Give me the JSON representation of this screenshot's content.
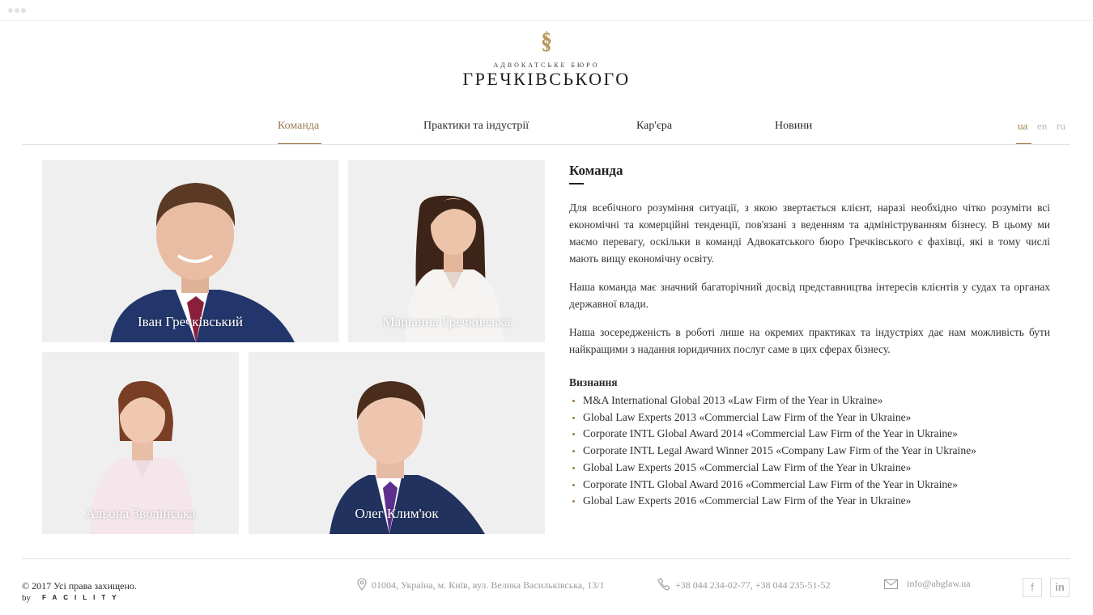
{
  "logo": {
    "subtitle": "Адвокатське бюро",
    "name": "ГРЕЧКІВСЬКОГО"
  },
  "nav": {
    "items": [
      {
        "label": "Команда",
        "active": true
      },
      {
        "label": "Практики та індустрії",
        "active": false
      },
      {
        "label": "Кар'єра",
        "active": false
      },
      {
        "label": "Новини",
        "active": false
      }
    ],
    "languages": [
      {
        "label": "ua",
        "active": true
      },
      {
        "label": "en",
        "active": false
      },
      {
        "label": "ru",
        "active": false
      }
    ]
  },
  "team": [
    {
      "name": "Іван Гречківський"
    },
    {
      "name": "Маріанна Гречківська"
    },
    {
      "name": "Альона Зволінська"
    },
    {
      "name": "Олег Клим'юк"
    }
  ],
  "content": {
    "title": "Команда",
    "paragraphs": [
      "Для всебічного розуміння ситуації, з якою звертається клієнт, наразі необхідно чітко розуміти всі економічні та комерційні тенденції, пов'язані з веденням та адмініструванням бізнесу. В цьому ми маємо перевагу, оскільки в команді Адвокатського бюро Гречківського є фахівці, які в тому числі мають вищу економічну освіту.",
      "Наша команда має значний багаторічний досвід представництва інтересів клієнтів у судах та органах державної влади.",
      "Наша зосередженість в роботі лише на окремих практиках та індустріях дає нам можливість бути найкращими з надання юридичних послуг саме в цих сферах бізнесу."
    ],
    "recognition_title": "Визнання",
    "recognitions": [
      "M&A International Global 2013 «Law Firm of the Year in Ukraine»",
      "Global Law Experts 2013 «Commercial Law Firm of the Year in Ukraine»",
      "Corporate INTL Global Award 2014 «Commercial Law Firm of the Year in Ukraine»",
      "Corporate INTL Legal Award Winner 2015 «Company Law Firm of the Year in Ukraine»",
      "Global Law Experts 2015 «Commercial Law Firm of the Year in Ukraine»",
      "Corporate INTL Global Award 2016 «Commercial Law Firm of the Year in Ukraine»",
      "Global Law Experts 2016  «Commercial Law Firm of the Year in Ukraine»"
    ]
  },
  "footer": {
    "copyright": "© 2017 Усі права захищено.",
    "by": "by",
    "developer": "FACILITY",
    "address": "01004, Україна, м. Київ, вул. Велика Васильківська, 13/1",
    "phones": "+38 044 234-02-77, +38 044 235-51-52",
    "email": "info@abglaw.ua",
    "social": {
      "facebook": "f",
      "linkedin": "in"
    }
  },
  "colors": {
    "accent": "#9b7b4e",
    "text": "#2a2a2a",
    "muted": "#9a9a9a",
    "photo_bg": "#efefef"
  },
  "icons": [
    "section-mark-icon",
    "location-pin-icon",
    "phone-icon",
    "envelope-icon",
    "facebook-icon",
    "linkedin-icon"
  ]
}
